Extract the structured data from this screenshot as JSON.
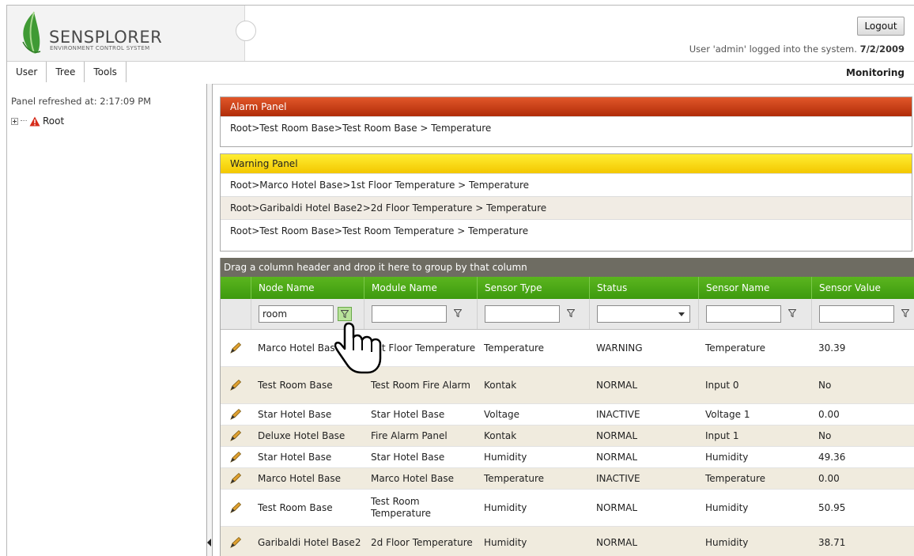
{
  "header": {
    "logo_name": "SENSPLORER",
    "logo_sub": "ENVIRONMENT CONTROL SYSTEM",
    "logout_label": "Logout",
    "user_line": "User 'admin' logged into the system.",
    "date": "7/2/2009"
  },
  "toolbar": {
    "menu": [
      "User",
      "Tree",
      "Tools"
    ],
    "mode": "Monitoring"
  },
  "left_panel": {
    "refreshed": "Panel refreshed at: 2:17:09 PM",
    "tree_root": "Root"
  },
  "alarm_panel": {
    "title": "Alarm Panel",
    "rows": [
      "Root>Test Room Base>Test Room Base > Temperature"
    ]
  },
  "warning_panel": {
    "title": "Warning Panel",
    "rows": [
      "Root>Marco Hotel Base>1st Floor Temperature > Temperature",
      "Root>Garibaldi Hotel Base2>2d Floor Temperature > Temperature",
      "Root>Test Room Base>Test Room Temperature > Temperature"
    ]
  },
  "grid": {
    "group_hint": "Drag a column header and drop it here to group by that column",
    "columns": [
      "Node Name",
      "Module Name",
      "Sensor Type",
      "Status",
      "Sensor Name",
      "Sensor Value"
    ],
    "filter_node_name": "room",
    "rows": [
      [
        "Marco Hotel Base",
        "1st Floor Temperature",
        "Temperature",
        "WARNING",
        "Temperature",
        "30.39"
      ],
      [
        "Test Room Base",
        "Test Room Fire Alarm",
        "Kontak",
        "NORMAL",
        "Input 0",
        "No"
      ],
      [
        "Star Hotel Base",
        "Star Hotel Base",
        "Voltage",
        "INACTIVE",
        "Voltage 1",
        "0.00"
      ],
      [
        "Deluxe Hotel Base",
        "Fire Alarm Panel",
        "Kontak",
        "NORMAL",
        "Input 1",
        "No"
      ],
      [
        "Star Hotel Base",
        "Star Hotel Base",
        "Humidity",
        "NORMAL",
        "Humidity",
        "49.36"
      ],
      [
        "Marco Hotel Base",
        "Marco Hotel Base",
        "Temperature",
        "INACTIVE",
        "Temperature",
        "0.00"
      ],
      [
        "Test Room Base",
        "Test Room Temperature",
        "Humidity",
        "NORMAL",
        "Humidity",
        "50.95"
      ],
      [
        "Garibaldi Hotel Base2",
        "2d Floor Temperature",
        "Humidity",
        "NORMAL",
        "Humidity",
        "38.71"
      ]
    ]
  },
  "colors": {
    "alarm": "#c8401a",
    "warning": "#f5d300",
    "grid_header": "#4aa517",
    "group_bar": "#6e6c62",
    "row_alt": "#f0ebde"
  },
  "icons": [
    "leaf-logo-icon",
    "alarm-triangle-icon",
    "filter-icon",
    "pencil-edit-icon",
    "hand-cursor-icon"
  ]
}
